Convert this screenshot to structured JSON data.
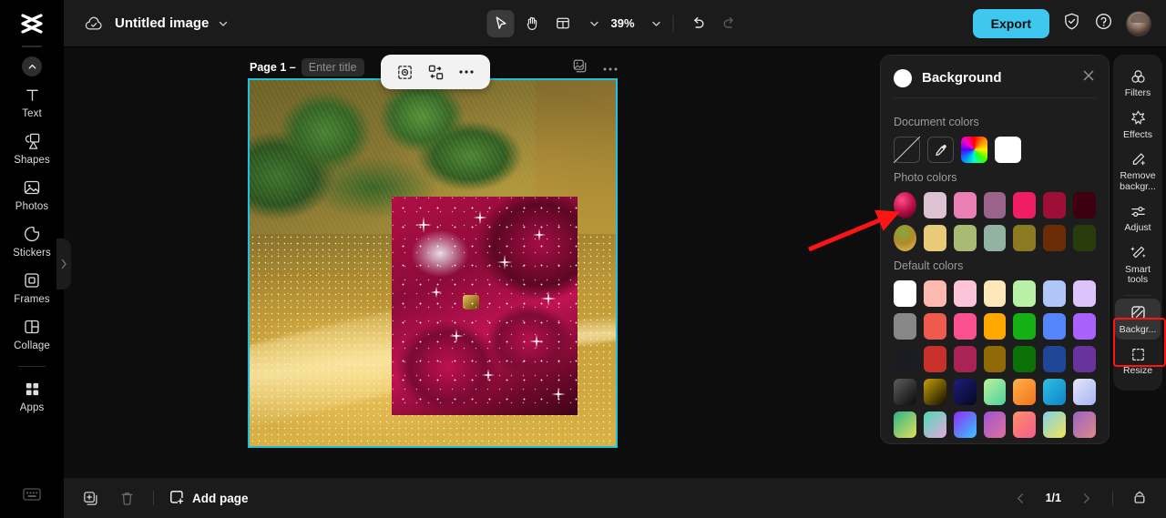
{
  "app": {
    "logo_icon": "capcut-logo-icon"
  },
  "topbar": {
    "cloud_icon": "cloud-saved-icon",
    "doc_title": "Untitled image",
    "title_chevron_icon": "chevron-down-icon",
    "select_tool_icon": "cursor-arrow-icon",
    "hand_tool_icon": "hand-pan-icon",
    "layout_tool_icon": "layout-panel-icon",
    "layout_chevron_icon": "chevron-down-icon",
    "zoom_value": "39%",
    "zoom_chevron_icon": "chevron-down-icon",
    "undo_icon": "undo-icon",
    "redo_icon": "redo-icon",
    "export_label": "Export",
    "shield_icon": "shield-check-icon",
    "help_icon": "question-circle-icon",
    "avatar_name": "user-avatar"
  },
  "sidebar": {
    "collapse_icon": "chevron-up-icon",
    "expand_icon": "chevron-right-icon",
    "items": [
      {
        "label": "Text",
        "icon": "text-icon"
      },
      {
        "label": "Shapes",
        "icon": "shapes-icon"
      },
      {
        "label": "Photos",
        "icon": "photos-icon"
      },
      {
        "label": "Stickers",
        "icon": "stickers-icon"
      },
      {
        "label": "Frames",
        "icon": "frames-icon"
      },
      {
        "label": "Collage",
        "icon": "collage-icon"
      },
      {
        "label": "Apps",
        "icon": "apps-grid-icon"
      }
    ],
    "bottom_icon": "keyboard-shortcuts-icon"
  },
  "canvas": {
    "page_label": "Page 1 –",
    "title_placeholder": "Enter title",
    "duplicate_page_icon": "duplicate-page-icon",
    "page_more_icon": "more-horizontal-icon",
    "float_toolbar": [
      {
        "icon": "cutout-select-icon"
      },
      {
        "icon": "replace-media-icon"
      },
      {
        "icon": "more-horizontal-icon"
      }
    ],
    "selection_color": "#1fc0e0"
  },
  "background_panel": {
    "title": "Background",
    "swatch_icon": "current-background-swatch",
    "close_icon": "close-icon",
    "sections": [
      {
        "label": "Document colors",
        "swatches": [
          {
            "type": "none",
            "name": "no-color-swatch",
            "color": "transparent"
          },
          {
            "type": "picker",
            "name": "eyedropper-swatch",
            "color": "transparent"
          },
          {
            "type": "wheel",
            "name": "color-wheel-swatch",
            "color": "rainbow"
          },
          {
            "type": "solid",
            "name": "color-swatch",
            "color": "#ffffff"
          }
        ]
      },
      {
        "label": "Photo colors",
        "rows": [
          [
            {
              "type": "photo",
              "name": "photo-thumb-swatch",
              "color": "#b01048"
            },
            {
              "type": "solid",
              "name": "color-swatch",
              "color": "#dcc2d3"
            },
            {
              "type": "solid",
              "name": "color-swatch",
              "color": "#ea7fb6"
            },
            {
              "type": "solid",
              "name": "color-swatch",
              "color": "#9a6389"
            },
            {
              "type": "solid",
              "name": "color-swatch",
              "color": "#ef1d63"
            },
            {
              "type": "solid",
              "name": "color-swatch",
              "color": "#9d0f37"
            },
            {
              "type": "solid",
              "name": "color-swatch",
              "color": "#3e0011"
            }
          ],
          [
            {
              "type": "photo",
              "name": "photo-thumb-swatch",
              "color": "#a98632"
            },
            {
              "type": "solid",
              "name": "color-swatch",
              "color": "#e9cb77"
            },
            {
              "type": "solid",
              "name": "color-swatch",
              "color": "#a9bb73"
            },
            {
              "type": "solid",
              "name": "color-swatch",
              "color": "#92b3a2"
            },
            {
              "type": "solid",
              "name": "color-swatch",
              "color": "#8b7a22"
            },
            {
              "type": "solid",
              "name": "color-swatch",
              "color": "#6a2d06"
            },
            {
              "type": "solid",
              "name": "color-swatch",
              "color": "#2a3b0c"
            }
          ]
        ]
      },
      {
        "label": "Default colors",
        "rows": [
          [
            {
              "type": "solid",
              "name": "color-swatch",
              "color": "#ffffff"
            },
            {
              "type": "solid",
              "name": "color-swatch",
              "color": "#fdb8b0"
            },
            {
              "type": "solid",
              "name": "color-swatch",
              "color": "#fdc3d9"
            },
            {
              "type": "solid",
              "name": "color-swatch",
              "color": "#ffe7bc"
            },
            {
              "type": "solid",
              "name": "color-swatch",
              "color": "#b8f0a8"
            },
            {
              "type": "solid",
              "name": "color-swatch",
              "color": "#b0c6f8"
            },
            {
              "type": "solid",
              "name": "color-swatch",
              "color": "#dcc3fb"
            }
          ],
          [
            {
              "type": "solid",
              "name": "color-swatch",
              "color": "#878787"
            },
            {
              "type": "solid",
              "name": "color-swatch",
              "color": "#ef5a4f"
            },
            {
              "type": "solid",
              "name": "color-swatch",
              "color": "#fb5090"
            },
            {
              "type": "solid",
              "name": "color-swatch",
              "color": "#ffa800"
            },
            {
              "type": "solid",
              "name": "color-swatch",
              "color": "#14b014"
            },
            {
              "type": "solid",
              "name": "color-swatch",
              "color": "#5585fb"
            },
            {
              "type": "solid",
              "name": "color-swatch",
              "color": "#a961fb"
            }
          ],
          [
            {
              "type": "solid",
              "name": "color-swatch",
              "color": "#1a1c22"
            },
            {
              "type": "solid",
              "name": "color-swatch",
              "color": "#c8302c"
            },
            {
              "type": "solid",
              "name": "color-swatch",
              "color": "#ab2255"
            },
            {
              "type": "solid",
              "name": "color-swatch",
              "color": "#906a06"
            },
            {
              "type": "solid",
              "name": "color-swatch",
              "color": "#0a7207"
            },
            {
              "type": "solid",
              "name": "color-swatch",
              "color": "#1f4697"
            },
            {
              "type": "solid",
              "name": "color-swatch",
              "color": "#68339c"
            }
          ],
          [
            {
              "type": "gradient",
              "name": "gradient-swatch",
              "color": "linear-gradient(135deg,#5e5e5e,#0a0a0a)"
            },
            {
              "type": "gradient",
              "name": "gradient-swatch",
              "color": "linear-gradient(135deg,#c6a008,#100c00)"
            },
            {
              "type": "gradient",
              "name": "gradient-swatch",
              "color": "linear-gradient(135deg,#1d1f7d,#060620)"
            },
            {
              "type": "gradient",
              "name": "gradient-swatch",
              "color": "linear-gradient(135deg,#b9f29a,#4fd0a0)"
            },
            {
              "type": "gradient",
              "name": "gradient-swatch",
              "color": "linear-gradient(135deg,#ffb14a,#f2721a)"
            },
            {
              "type": "gradient",
              "name": "gradient-swatch",
              "color": "linear-gradient(135deg,#32bde4,#0c84c8)"
            },
            {
              "type": "gradient",
              "name": "gradient-swatch",
              "color": "linear-gradient(135deg,#e6e4fb,#a6b6f2)"
            }
          ],
          [
            {
              "type": "gradient",
              "name": "gradient-swatch",
              "color": "linear-gradient(135deg,#2fb388,#e0e05a)"
            },
            {
              "type": "gradient",
              "name": "gradient-swatch",
              "color": "linear-gradient(135deg,#4ed9b1,#e7a8e0)"
            },
            {
              "type": "gradient",
              "name": "gradient-swatch",
              "color": "linear-gradient(135deg,#8f2bf5,#38c8ff)"
            },
            {
              "type": "gradient",
              "name": "gradient-swatch",
              "color": "linear-gradient(135deg,#9c55d2,#e0719a)"
            },
            {
              "type": "gradient",
              "name": "gradient-swatch",
              "color": "linear-gradient(135deg,#ff8f6a,#f25d8a)"
            },
            {
              "type": "gradient",
              "name": "gradient-swatch",
              "color": "linear-gradient(135deg,#7fd2e8,#f2e45a)"
            },
            {
              "type": "gradient",
              "name": "gradient-swatch",
              "color": "linear-gradient(135deg,#9a62c2,#e08a88)"
            }
          ]
        ]
      }
    ]
  },
  "right_rail": {
    "items": [
      {
        "label": "Filters",
        "icon": "filters-icon",
        "selected": false
      },
      {
        "label": "Effects",
        "icon": "effects-icon",
        "selected": false
      },
      {
        "label": "Remove\nbackgr...",
        "icon": "remove-background-icon",
        "selected": false
      },
      {
        "label": "Adjust",
        "icon": "adjust-sliders-icon",
        "selected": false
      },
      {
        "label": "Smart\ntools",
        "icon": "smart-tools-icon",
        "selected": false
      },
      {
        "label": "Backgr...",
        "icon": "background-icon",
        "selected": true
      },
      {
        "label": "Resize",
        "icon": "resize-icon",
        "selected": false
      }
    ],
    "highlight_color": "#ff1414"
  },
  "bottombar": {
    "duplicate_icon": "duplicate-icon",
    "delete_icon": "trash-icon",
    "add_page_icon": "add-page-icon",
    "add_page_label": "Add page",
    "prev_icon": "chevron-left-icon",
    "page_indicator": "1/1",
    "next_icon": "chevron-right-icon",
    "timeline_icon": "timeline-icon"
  },
  "annotation": {
    "arrow_name": "red-pointer-arrow",
    "color": "#ff1414"
  }
}
